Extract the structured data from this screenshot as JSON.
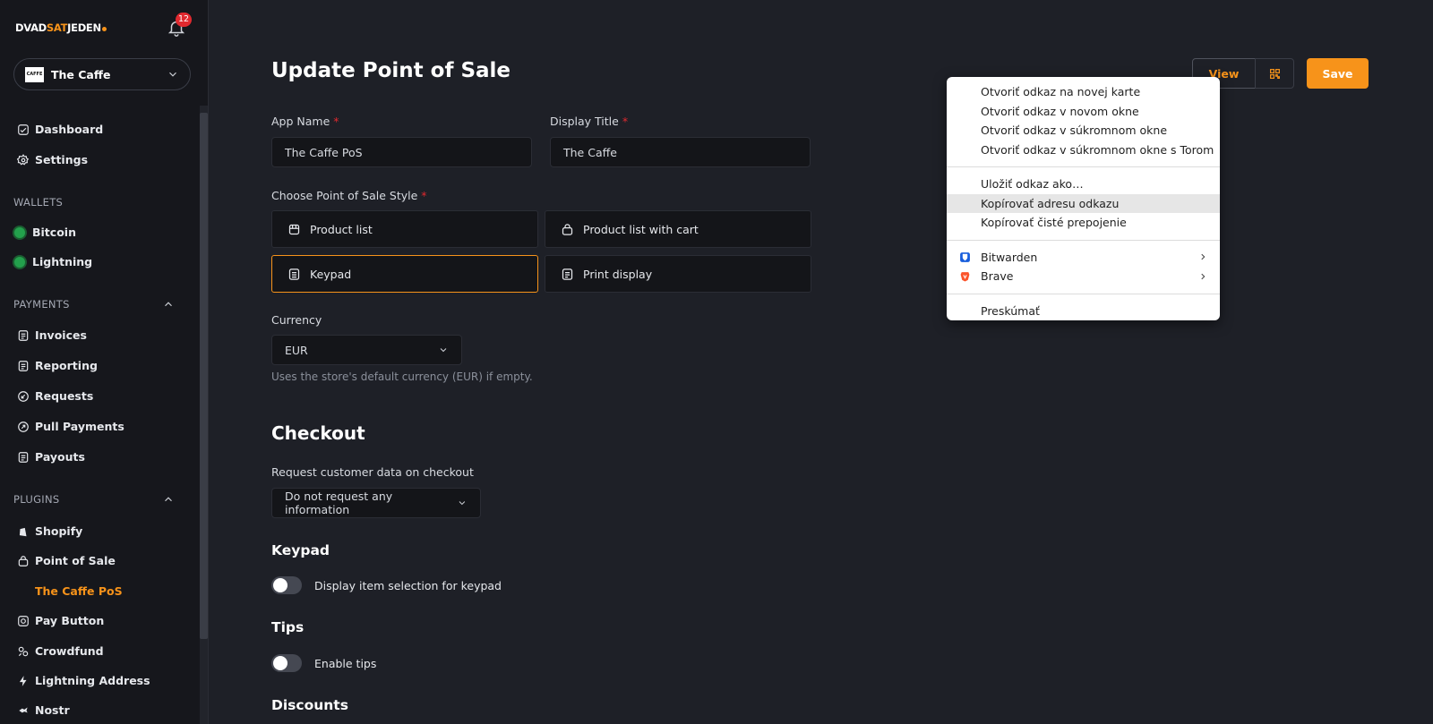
{
  "brand": {
    "part1": "DVAD",
    "part2": "SAT",
    "part3": "JEDEN"
  },
  "notifications": {
    "count": "12"
  },
  "store": {
    "logo_text": "CAFFE",
    "name": "The Caffe"
  },
  "nav": {
    "dashboard": "Dashboard",
    "settings": "Settings",
    "wallets_header": "WALLETS",
    "bitcoin": "Bitcoin",
    "lightning": "Lightning",
    "payments_header": "PAYMENTS",
    "invoices": "Invoices",
    "reporting": "Reporting",
    "requests": "Requests",
    "pull_payments": "Pull Payments",
    "payouts": "Payouts",
    "plugins_header": "PLUGINS",
    "shopify": "Shopify",
    "point_of_sale": "Point of Sale",
    "the_caffe_pos": "The Caffe PoS",
    "pay_button": "Pay Button",
    "crowdfund": "Crowdfund",
    "lightning_address": "Lightning Address",
    "nostr": "Nostr"
  },
  "header": {
    "title": "Update Point of Sale",
    "view_label": "View",
    "save_label": "Save"
  },
  "form": {
    "app_name_label": "App Name",
    "app_name_value": "The Caffe PoS",
    "display_title_label": "Display Title",
    "display_title_value": "The Caffe",
    "required_mark": "*",
    "style_label": "Choose Point of Sale Style",
    "styles": {
      "product_list": "Product list",
      "product_list_cart": "Product list with cart",
      "keypad": "Keypad",
      "print_display": "Print display"
    },
    "currency_label": "Currency",
    "currency_value": "EUR",
    "currency_hint": "Uses the store's default currency (EUR) if empty."
  },
  "checkout": {
    "title": "Checkout",
    "request_label": "Request customer data on checkout",
    "request_value": "Do not request any information",
    "keypad_title": "Keypad",
    "keypad_toggle_label": "Display item selection for keypad",
    "tips_title": "Tips",
    "tips_toggle_label": "Enable tips",
    "discounts_title": "Discounts"
  },
  "context_menu": {
    "open_new_tab": "Otvoriť odkaz na novej karte",
    "open_new_window": "Otvoriť odkaz v novom okne",
    "open_private": "Otvoriť odkaz v  súkromnom okne",
    "open_tor": "Otvoriť odkaz v súkromnom okne s Torom",
    "save_link": "Uložiť odkaz ako…",
    "copy_link": "Kopírovať adresu odkazu",
    "copy_clean": "Kopírovať čisté prepojenie",
    "bitwarden": "Bitwarden",
    "brave": "Brave",
    "inspect": "Preskúmať"
  },
  "colors": {
    "accent": "#f7931a",
    "background": "#1e2027",
    "sidebar": "#16171c",
    "status_green": "#23a04c",
    "badge_red": "#e0292f"
  },
  "icons": {
    "notification": "bell-icon",
    "bitwarden": "bitwarden-icon",
    "brave": "brave-lion-icon"
  }
}
